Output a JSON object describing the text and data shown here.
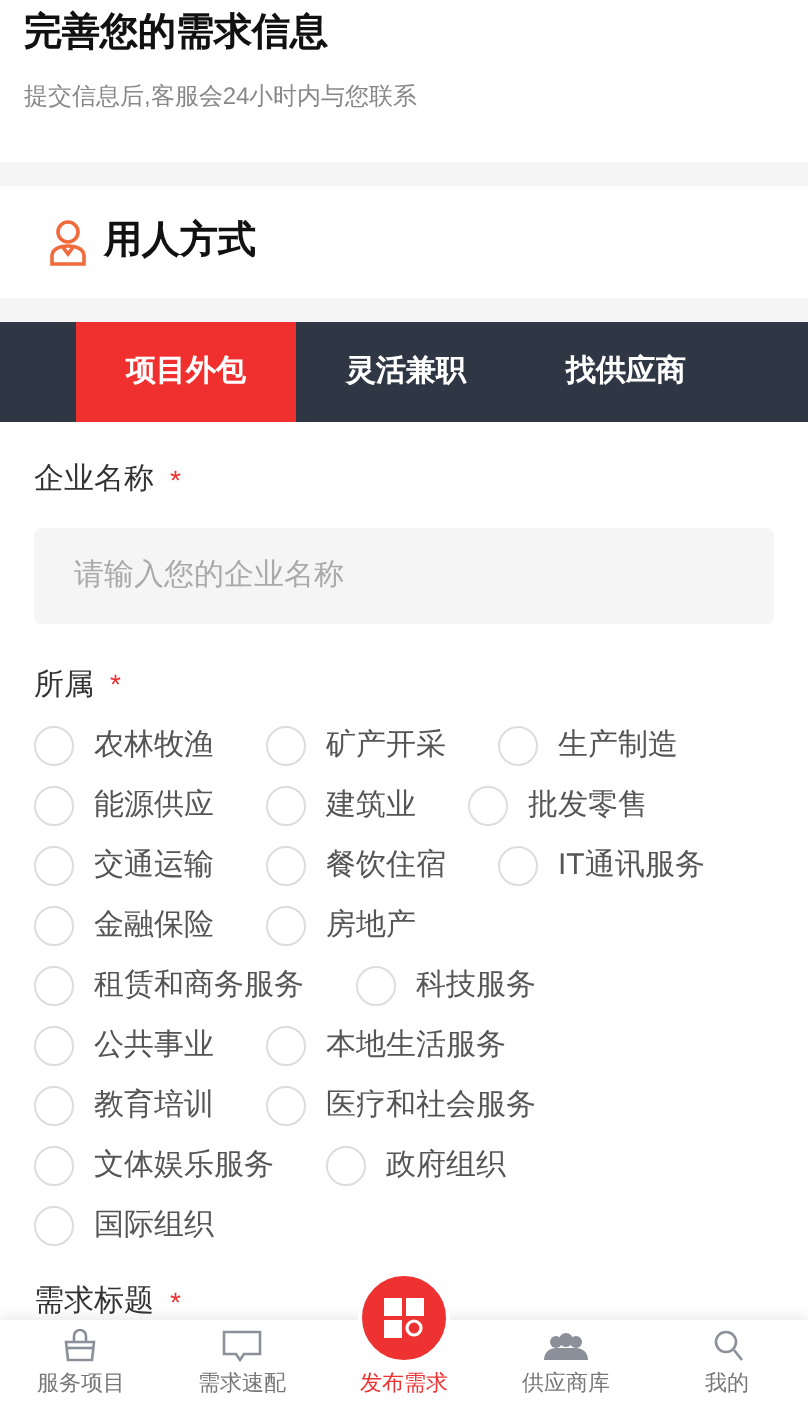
{
  "header": {
    "title": "完善您的需求信息",
    "subtitle": "提交信息后,客服会24小时内与您联系"
  },
  "section": {
    "title": "用人方式"
  },
  "tabs": [
    {
      "label": "项目外包",
      "selected": true
    },
    {
      "label": "灵活兼职",
      "selected": false
    },
    {
      "label": "找供应商",
      "selected": false
    }
  ],
  "company": {
    "label": "企业名称",
    "required_mark": "*",
    "placeholder": "请输入您的企业名称"
  },
  "industry": {
    "label": "所属",
    "required_mark": "*",
    "option_rows": [
      [
        {
          "label": "农林牧渔",
          "selected": false
        },
        {
          "label": "矿产开采",
          "selected": false
        },
        {
          "label": "生产制造",
          "selected": false
        }
      ],
      [
        {
          "label": "能源供应",
          "selected": false
        },
        {
          "label": "建筑业",
          "selected": false
        },
        {
          "label": "批发零售",
          "selected": false
        }
      ],
      [
        {
          "label": "交通运输",
          "selected": false
        },
        {
          "label": "餐饮住宿",
          "selected": false
        },
        {
          "label": "IT通讯服务",
          "selected": false
        }
      ],
      [
        {
          "label": "金融保险",
          "selected": false
        },
        {
          "label": "房地产",
          "selected": false
        }
      ],
      [
        {
          "label": "租赁和商务服务",
          "selected": false
        },
        {
          "label": "科技服务",
          "selected": false
        }
      ],
      [
        {
          "label": "公共事业",
          "selected": false
        },
        {
          "label": "本地生活服务",
          "selected": false
        }
      ],
      [
        {
          "label": "教育培训",
          "selected": false
        },
        {
          "label": "医疗和社会服务",
          "selected": false
        }
      ],
      [
        {
          "label": "文体娱乐服务",
          "selected": false
        },
        {
          "label": "政府组织",
          "selected": false
        }
      ],
      [
        {
          "label": "国际组织",
          "selected": false
        }
      ]
    ]
  },
  "demand_title": {
    "label": "需求标题",
    "required_mark": "*"
  },
  "bottom_nav": [
    {
      "label": "服务项目",
      "kind": "bag",
      "selected": false
    },
    {
      "label": "需求速配",
      "kind": "chat",
      "selected": false
    },
    {
      "label": "发布需求",
      "kind": "publish",
      "selected": true
    },
    {
      "label": "供应商库",
      "kind": "store",
      "selected": false
    },
    {
      "label": "我的",
      "kind": "person",
      "selected": false
    }
  ]
}
